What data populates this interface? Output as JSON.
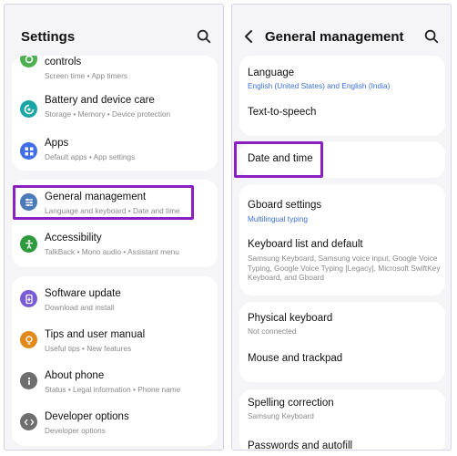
{
  "left": {
    "title": "Settings",
    "items": [
      {
        "label": "controls",
        "sub": "Screen time  •  App timers",
        "icon": "screen-time-icon",
        "color": "#4caf50"
      },
      {
        "label": "Battery and device care",
        "sub": "Storage  •  Memory  •  Device protection",
        "icon": "device-care-icon",
        "color": "#1aa6a6"
      },
      {
        "label": "Apps",
        "sub": "Default apps  •  App settings",
        "icon": "apps-icon",
        "color": "#3f6ee8"
      },
      {
        "label": "General management",
        "sub": "Language and keyboard  •  Date and time",
        "icon": "sliders-icon",
        "color": "#4a7ab7"
      },
      {
        "label": "Accessibility",
        "sub": "TalkBack  •  Mono audio  •  Assistant menu",
        "icon": "accessibility-icon",
        "color": "#2e9a3e"
      },
      {
        "label": "Software update",
        "sub": "Download and install",
        "icon": "software-update-icon",
        "color": "#7a5bd6"
      },
      {
        "label": "Tips and user manual",
        "sub": "Useful tips  •  New features",
        "icon": "tips-icon",
        "color": "#e08a1c"
      },
      {
        "label": "About phone",
        "sub": "Status  •  Legal information  •  Phone name",
        "icon": "info-icon",
        "color": "#6e6e6e"
      },
      {
        "label": "Developer options",
        "sub": "Developer options",
        "icon": "developer-icon",
        "color": "#6e6e6e"
      }
    ]
  },
  "right": {
    "title": "General management",
    "items": [
      {
        "label": "Language",
        "sub": "English (United States) and English (India)"
      },
      {
        "label": "Text-to-speech",
        "sub": ""
      },
      {
        "label": "Date and time",
        "sub": ""
      },
      {
        "label": "Gboard settings",
        "sub": "Multilingual typing"
      },
      {
        "label": "Keyboard list and default",
        "sub": "Samsung Keyboard, Samsung voice input, Google Voice Typing, Google Voice Typing [Legacy], Microsoft SwiftKey Keyboard, and Gboard"
      },
      {
        "label": "Physical keyboard",
        "sub": "Not connected"
      },
      {
        "label": "Mouse and trackpad",
        "sub": ""
      },
      {
        "label": "Spelling correction",
        "sub": "Samsung Keyboard"
      },
      {
        "label": "Passwords and autofill",
        "sub": ""
      }
    ]
  },
  "colors": {
    "highlight": "#8a1fc2",
    "accent_blue": "#3b6fd8"
  }
}
